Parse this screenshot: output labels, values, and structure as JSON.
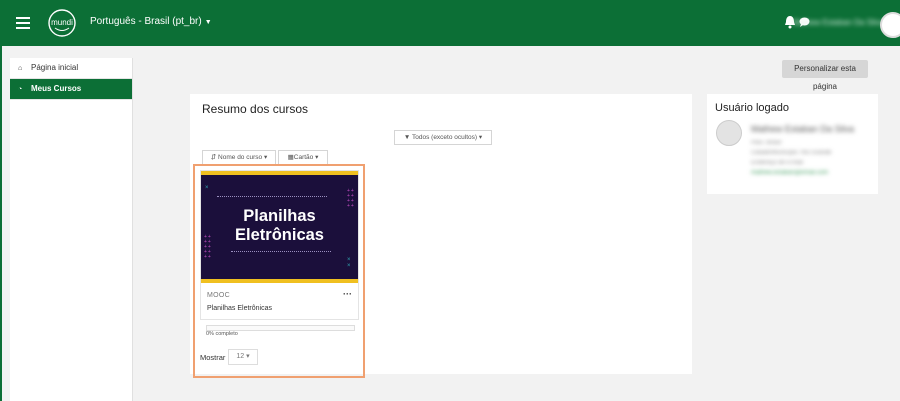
{
  "navbar": {
    "language": "Português - Brasil (pt_br)",
    "logo_text": "mundi",
    "user_name": "Mathew Estaban Da Silva"
  },
  "sidebar": {
    "items": [
      {
        "label": "Página inicial",
        "icon": "home-icon"
      },
      {
        "label": "Meus Cursos",
        "icon": "dashboard-icon"
      }
    ]
  },
  "customize_label": "Personalizar esta página",
  "main": {
    "title": "Resumo dos cursos",
    "filter_label": "Todos (exceto ocultos)",
    "sort_label": "Nome do curso",
    "view_label": "Cartão",
    "course": {
      "image_title_line1": "Planilhas",
      "image_title_line2": "Eletrônicas",
      "category": "MOOC",
      "name": "Planilhas Eletrônicas",
      "progress_text": "0% completo",
      "progress": 0
    },
    "show_label": "Mostrar",
    "show_value": "12"
  },
  "right_panel": {
    "title": "Usuário logado",
    "user_name": "Mathew Estaban Da Silva",
    "lines": [
      "País: Brasil",
      "Cidade/Município: Rio Grande",
      "Endereço de e-mail",
      "mathew.estaban@email.com"
    ]
  },
  "colors": {
    "brand_green": "#0c6f36",
    "highlight": "#f0a070",
    "course_bg": "#1b0f3b",
    "accent_yellow": "#f0c020"
  }
}
